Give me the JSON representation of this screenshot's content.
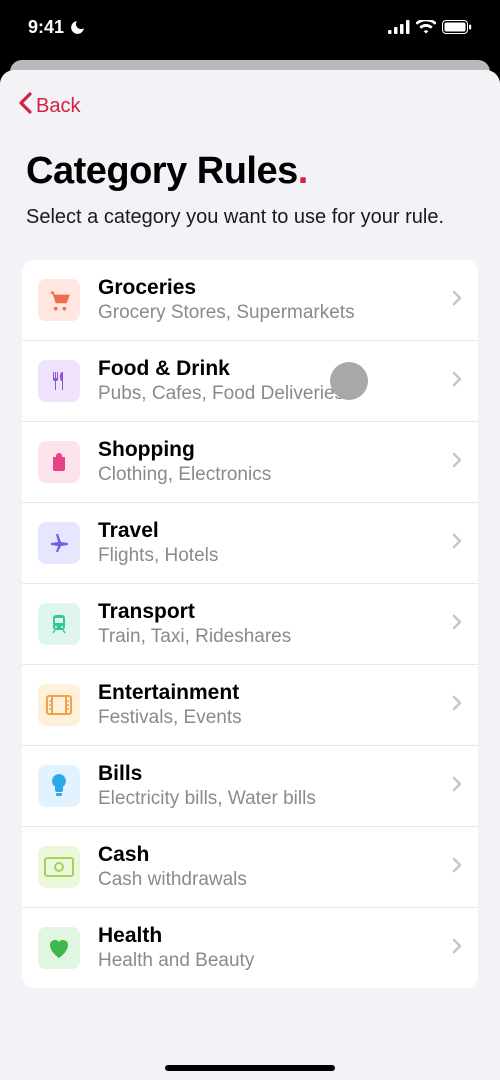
{
  "status": {
    "time": "9:41"
  },
  "nav": {
    "back": "Back"
  },
  "title": "Category Rules",
  "title_dot": ".",
  "subtitle": "Select a category you want to use for your rule.",
  "categories": {
    "groceries": {
      "name": "Groceries",
      "desc": "Grocery Stores, Supermarkets"
    },
    "food": {
      "name": "Food & Drink",
      "desc": "Pubs, Cafes, Food Deliveries"
    },
    "shopping": {
      "name": "Shopping",
      "desc": "Clothing, Electronics"
    },
    "travel": {
      "name": "Travel",
      "desc": "Flights, Hotels"
    },
    "transport": {
      "name": "Transport",
      "desc": "Train, Taxi, Rideshares"
    },
    "entertainment": {
      "name": "Entertainment",
      "desc": "Festivals, Events"
    },
    "bills": {
      "name": "Bills",
      "desc": "Electricity bills, Water bills"
    },
    "cash": {
      "name": "Cash",
      "desc": "Cash withdrawals"
    },
    "health": {
      "name": "Health",
      "desc": "Health and Beauty"
    }
  }
}
